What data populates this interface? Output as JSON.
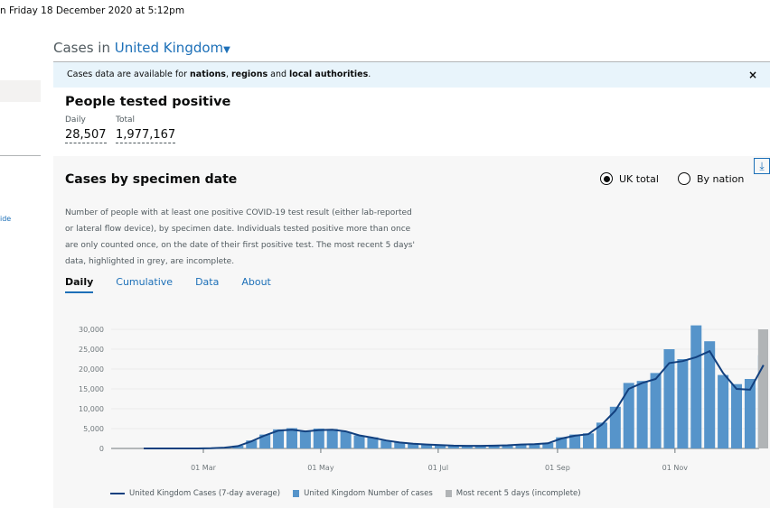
{
  "updated": "n Friday 18 December 2020 at 5:12pm",
  "sidebar": {
    "link_fragment": "ide"
  },
  "heading": {
    "prefix": "Cases in",
    "location": "United Kingdom"
  },
  "banner": {
    "text1": "Cases data are available for ",
    "nations": "nations",
    ",": ", ",
    "regions": "regions",
    "and": " and ",
    "local": "local authorities",
    "end": ".",
    "close": "×"
  },
  "summary": {
    "title": "People tested positive",
    "daily_label": "Daily",
    "daily_value": "28,507",
    "total_label": "Total",
    "total_value": "1,977,167"
  },
  "card": {
    "title": "Cases by specimen date",
    "description": "Number of people with at least one positive COVID-19 test result (either lab-reported or lateral flow device), by specimen date. Individuals tested positive more than once are only counted once, on the date of their first positive test. The most recent 5 days' data, highlighted in grey, are incomplete.",
    "radio_uk": "UK total",
    "radio_nation": "By nation",
    "tabs": [
      "Daily",
      "Cumulative",
      "Data",
      "About"
    ]
  },
  "chart_data": {
    "type": "bar",
    "x": [
      "2020-01-30",
      "2020-02-06",
      "2020-02-13",
      "2020-02-20",
      "2020-02-27",
      "2020-03-05",
      "2020-03-12",
      "2020-03-19",
      "2020-03-26",
      "2020-04-02",
      "2020-04-09",
      "2020-04-16",
      "2020-04-23",
      "2020-04-30",
      "2020-05-07",
      "2020-05-14",
      "2020-05-21",
      "2020-05-28",
      "2020-06-04",
      "2020-06-11",
      "2020-06-18",
      "2020-06-25",
      "2020-07-02",
      "2020-07-09",
      "2020-07-16",
      "2020-07-23",
      "2020-07-30",
      "2020-08-06",
      "2020-08-13",
      "2020-08-20",
      "2020-08-27",
      "2020-09-03",
      "2020-09-10",
      "2020-09-17",
      "2020-09-24",
      "2020-10-01",
      "2020-10-08",
      "2020-10-15",
      "2020-10-22",
      "2020-10-29",
      "2020-11-05",
      "2020-11-12",
      "2020-11-19",
      "2020-11-26",
      "2020-12-03",
      "2020-12-10",
      "2020-12-17"
    ],
    "series": [
      {
        "name": "United Kingdom Cases (7-day average)",
        "type": "line",
        "color": "#12407f",
        "values": [
          0,
          0,
          0,
          0,
          10,
          50,
          200,
          600,
          1800,
          3300,
          4500,
          4700,
          4300,
          4600,
          4700,
          4300,
          3300,
          2700,
          2000,
          1500,
          1200,
          1000,
          850,
          700,
          650,
          650,
          700,
          800,
          1000,
          1100,
          1300,
          2500,
          3200,
          3600,
          6000,
          9500,
          15000,
          16500,
          17500,
          21500,
          22000,
          23000,
          24500,
          19000,
          15000,
          14800,
          21000
        ]
      },
      {
        "name": "United Kingdom Number of cases",
        "type": "bar",
        "color": "#5694ca",
        "values": [
          2,
          1,
          2,
          5,
          15,
          60,
          250,
          700,
          2000,
          3500,
          4800,
          5100,
          4200,
          5000,
          4900,
          4200,
          3300,
          2800,
          2000,
          1500,
          1300,
          1000,
          900,
          750,
          700,
          700,
          750,
          850,
          1050,
          1150,
          1400,
          2800,
          3500,
          3800,
          6500,
          10500,
          16500,
          17000,
          19000,
          25000,
          22500,
          31000,
          27000,
          18500,
          16200,
          17500,
          23500
        ]
      },
      {
        "name": "Most recent 5 days (incomplete)",
        "type": "bar",
        "color": "#b1b4b6",
        "values": [
          null,
          null,
          null,
          null,
          null,
          null,
          null,
          null,
          null,
          null,
          null,
          null,
          null,
          null,
          null,
          null,
          null,
          null,
          null,
          null,
          null,
          null,
          null,
          null,
          null,
          null,
          null,
          null,
          null,
          null,
          null,
          null,
          null,
          null,
          null,
          null,
          null,
          null,
          null,
          null,
          null,
          null,
          null,
          null,
          null,
          null,
          30000
        ]
      }
    ],
    "ylim": [
      0,
      30000
    ],
    "yticks": [
      "0",
      "5,000",
      "10,000",
      "15,000",
      "20,000",
      "25,000",
      "30,000"
    ],
    "xticks": [
      {
        "date": "2020-03-01",
        "label": "01 Mar"
      },
      {
        "date": "2020-05-01",
        "label": "01 May"
      },
      {
        "date": "2020-07-01",
        "label": "01 Jul"
      },
      {
        "date": "2020-09-01",
        "label": "01 Sep"
      },
      {
        "date": "2020-11-01",
        "label": "01 Nov"
      }
    ],
    "grid": true,
    "legend": "bottom"
  }
}
